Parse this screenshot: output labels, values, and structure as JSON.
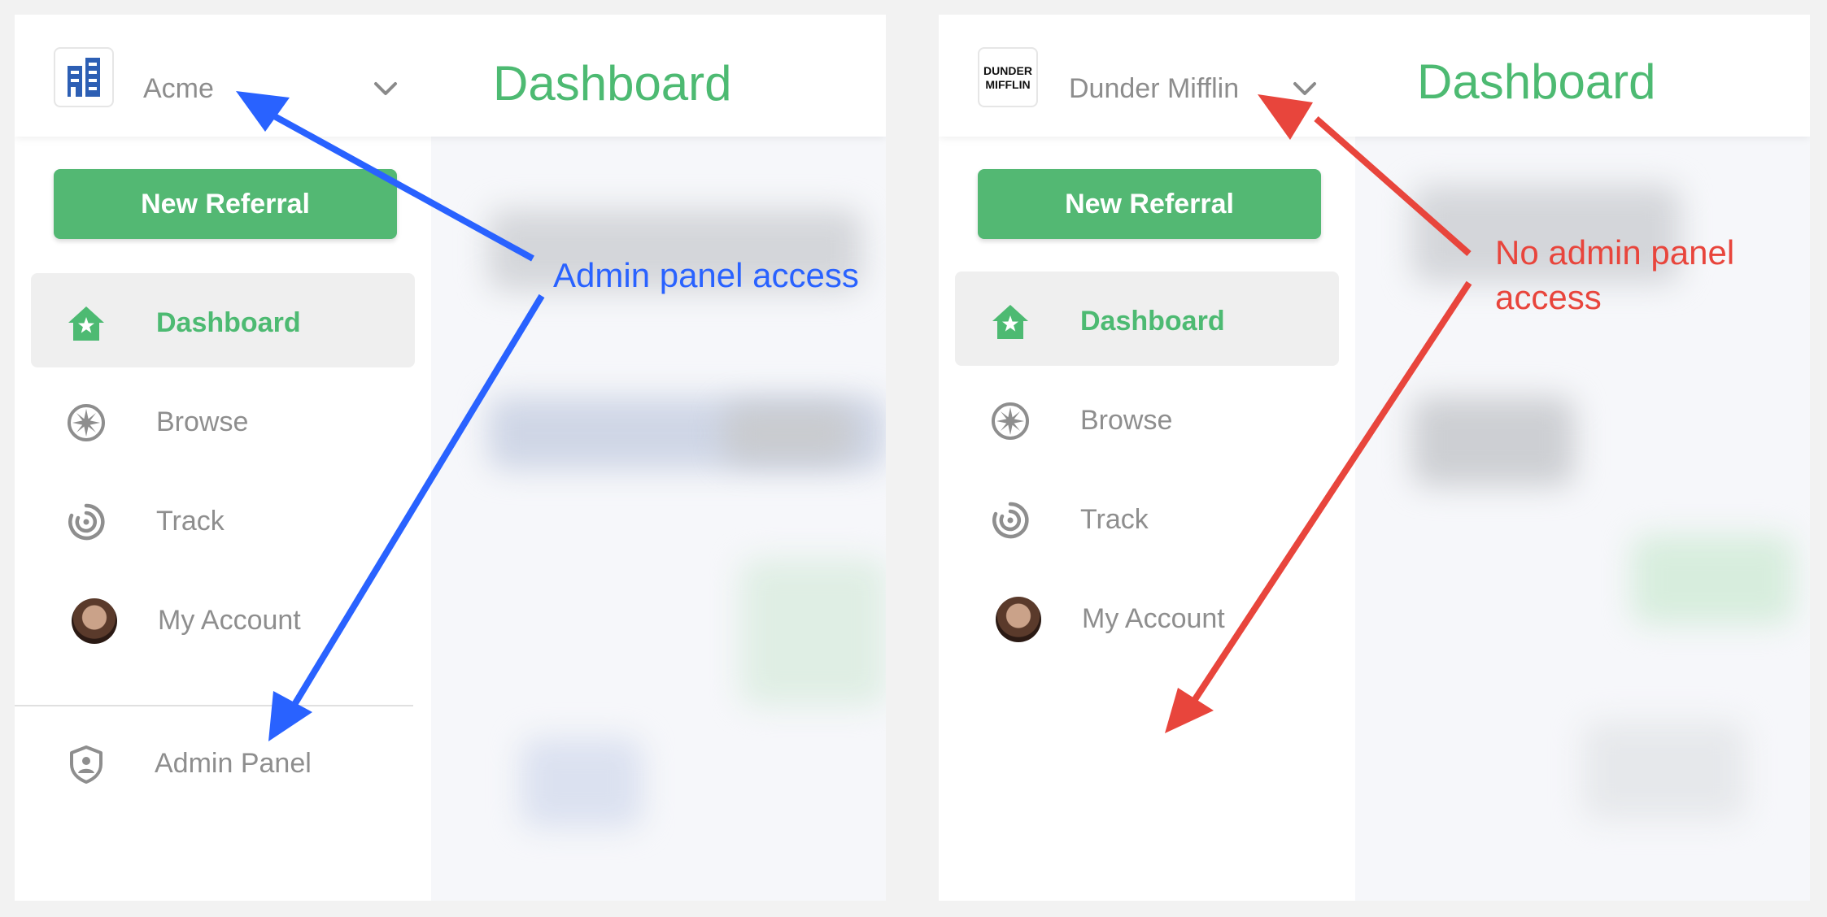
{
  "screens": [
    {
      "org": {
        "name": "Acme",
        "logo_icon": "building-icon"
      },
      "title": "Dashboard",
      "new_referral_label": "New Referral",
      "nav": [
        {
          "label": "Dashboard",
          "icon": "home-star-icon",
          "active": true
        },
        {
          "label": "Browse",
          "icon": "compass-icon"
        },
        {
          "label": "Track",
          "icon": "target-icon"
        },
        {
          "label": "My Account",
          "icon": "avatar"
        },
        {
          "label": "Admin Panel",
          "icon": "shield-user-icon"
        }
      ],
      "annotation": "Admin panel access"
    },
    {
      "org": {
        "name": "Dunder Mifflin",
        "logo_text": "DUNDER MIFFLIN"
      },
      "title": "Dashboard",
      "new_referral_label": "New Referral",
      "nav": [
        {
          "label": "Dashboard",
          "icon": "home-star-icon",
          "active": true
        },
        {
          "label": "Browse",
          "icon": "compass-icon"
        },
        {
          "label": "Track",
          "icon": "target-icon"
        },
        {
          "label": "My Account",
          "icon": "avatar"
        }
      ],
      "annotation": "No admin panel access"
    }
  ],
  "colors": {
    "brand_green": "#4dba72",
    "button_green": "#53b873",
    "annotation_blue": "#2962ff",
    "annotation_red": "#e8453c"
  }
}
